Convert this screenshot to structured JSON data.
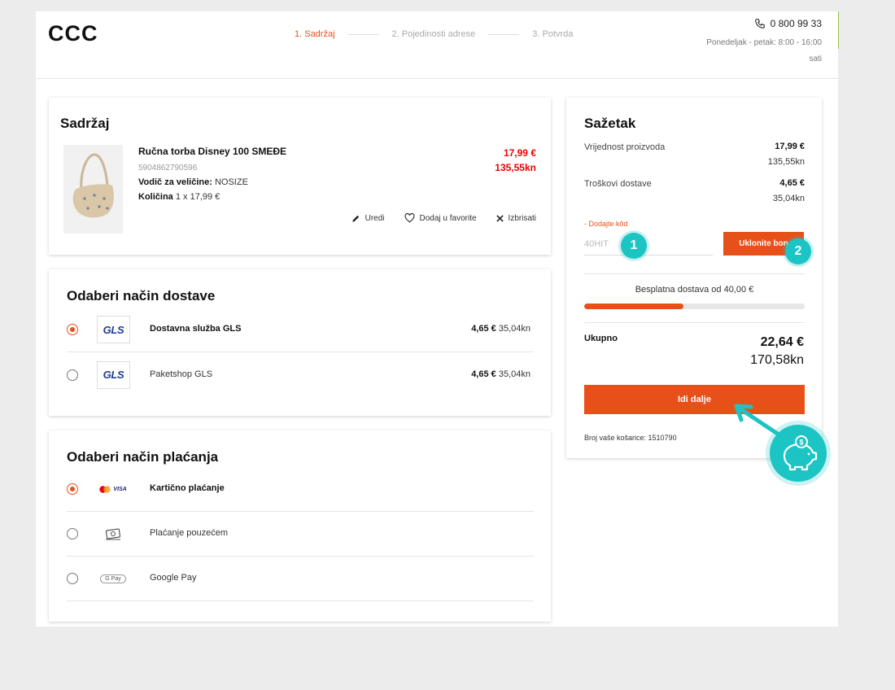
{
  "header": {
    "logo": "CCC",
    "steps": [
      "1. Sadržaj",
      "2. Pojedinosti adrese",
      "3. Potvrda"
    ],
    "phone": "0 800 99 33",
    "hours": "Ponedeljak - petak: 8:00 - 16:00 sati"
  },
  "content": {
    "title": "Sadržaj",
    "product": {
      "name": "Ručna torba Disney 100 SMEĐE",
      "sku": "5904862790596",
      "size_label": "Vodič za veličine:",
      "size_value": "NOSIZE",
      "qty_label": "Količina",
      "qty_value": "1 x 17,99 €",
      "price_eur": "17,99 €",
      "price_kn": "135,55kn"
    },
    "actions": {
      "edit": "Uredi",
      "favorite": "Dodaj u favorite",
      "delete": "Izbrisati"
    }
  },
  "delivery": {
    "title": "Odaberi način dostave",
    "options": [
      {
        "name": "Dostavna služba GLS",
        "price_eur": "4,65 €",
        "price_kn": "35,04kn",
        "selected": true,
        "logo": "GLS"
      },
      {
        "name": "Paketshop GLS",
        "price_eur": "4,65 €",
        "price_kn": "35,04kn",
        "selected": false,
        "logo": "GLS"
      }
    ]
  },
  "payment": {
    "title": "Odaberi način plaćanja",
    "options": [
      {
        "name": "Kartično plaćanje",
        "selected": true,
        "icon": "mastercard-visa-icon",
        "icon_text": "VISA"
      },
      {
        "name": "Plaćanje pouzećem",
        "selected": false,
        "icon": "cash-icon"
      },
      {
        "name": "Google Pay",
        "selected": false,
        "icon": "google-pay-icon",
        "icon_text": "G Pay"
      }
    ]
  },
  "summary": {
    "title": "Sažetak",
    "product_value_label": "Vrijednost proizvoda",
    "product_value_eur": "17,99 €",
    "product_value_kn": "135,55kn",
    "shipping_label": "Troškovi dostave",
    "shipping_eur": "4,65 €",
    "shipping_kn": "35,04kn",
    "code_label": "- Dodajte kôd",
    "code_value": "40HIT",
    "remove_button": "Uklonite bon",
    "free_shipping_text": "Besplatna dostava od 40,00 €",
    "free_shipping_progress": 0.45,
    "total_label": "Ukupno",
    "total_eur": "22,64 €",
    "total_kn": "170,58kn",
    "next_button": "Idi dalje",
    "cart_number": "Broj vaše košarice: 1510790"
  },
  "overlays": {
    "badge_1": "1",
    "badge_2": "2",
    "accent_color": "#1cc4c4"
  },
  "colors": {
    "brand": "#e8501a",
    "price_red": "#e00000"
  }
}
